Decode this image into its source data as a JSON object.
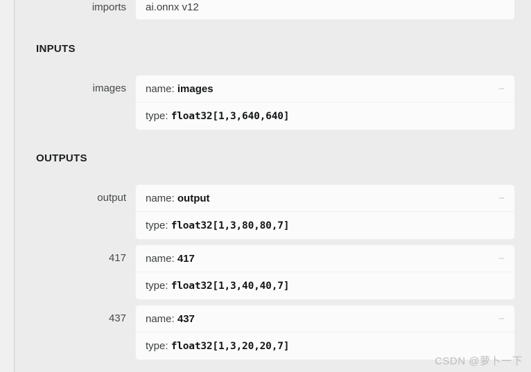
{
  "panel": {
    "imports": {
      "label": "imports",
      "value": "ai.onnx v12"
    },
    "sections": {
      "inputs_header": "INPUTS",
      "outputs_header": "OUTPUTS"
    },
    "name_prefix": "name:",
    "type_prefix": "type:",
    "collapse_icon": "minus-icon",
    "collapse_glyph": "−",
    "inputs": [
      {
        "label": "images",
        "name": "images",
        "type": "float32[1,3,640,640]"
      }
    ],
    "outputs": [
      {
        "label": "output",
        "name": "output",
        "type": "float32[1,3,80,80,7]"
      },
      {
        "label": "417",
        "name": "417",
        "type": "float32[1,3,40,40,7]"
      },
      {
        "label": "437",
        "name": "437",
        "type": "float32[1,3,20,20,7]"
      }
    ],
    "watermark": "CSDN @萝卜一下",
    "colors": {
      "page_background": "#ececec",
      "card_background": "#fbfbfb",
      "divider": "#cfcfcf",
      "label_text": "#44474a",
      "value_text": "#121416",
      "watermark_text": "#b9bcbf"
    }
  }
}
